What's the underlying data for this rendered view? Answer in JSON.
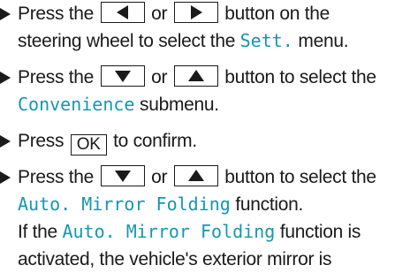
{
  "accent_color": "#1497b3",
  "steps": [
    {
      "line1_before": "Press the",
      "line1_mid": "or",
      "line1_after": "button on the",
      "line2_before": "steering wheel to select the",
      "line2_mono": "Sett.",
      "line2_after": "menu.",
      "buttons": [
        "left-arrow",
        "right-arrow"
      ]
    },
    {
      "line1_before": "Press the",
      "line1_mid": "or",
      "line1_after": "button to select the",
      "line2_mono": "Convenience",
      "line2_after": "submenu.",
      "buttons": [
        "down-arrow",
        "up-arrow"
      ]
    },
    {
      "line1_before": "Press",
      "ok_label": "OK",
      "line1_after": "to confirm."
    },
    {
      "line1_before": "Press the",
      "line1_mid": "or",
      "line1_after": "button to select the",
      "line2_mono": "Auto. Mirror Folding",
      "line2_after": "function.",
      "line3_before": "If the",
      "line3_mono": "Auto. Mirror Folding",
      "line3_after": "function is",
      "line4": "activated, the vehicle's exterior mirror is",
      "buttons": [
        "down-arrow",
        "up-arrow"
      ]
    }
  ]
}
